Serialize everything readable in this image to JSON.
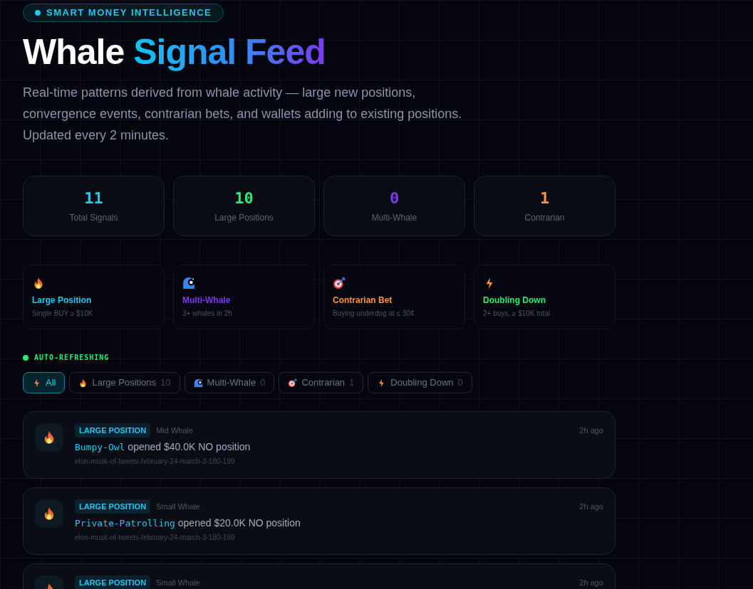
{
  "badge": "SMART MONEY INTELLIGENCE",
  "title": {
    "plain": "Whale",
    "accent": "Signal Feed"
  },
  "description": "Real-time patterns derived from whale activity — large new positions, convergence events, contrarian bets, and wallets adding to existing positions. Updated every 2 minutes.",
  "stats": [
    {
      "value": "11",
      "label": "Total Signals",
      "color": "#22c8ee"
    },
    {
      "value": "10",
      "label": "Large Positions",
      "color": "#22ee77"
    },
    {
      "value": "0",
      "label": "Multi-Whale",
      "color": "#7c3aed"
    },
    {
      "value": "1",
      "label": "Contrarian",
      "color": "#fb923c"
    }
  ],
  "signal_types": [
    {
      "kind": "flame",
      "name": "Large Position",
      "rule": "Single BUY ≥ $10K",
      "color": "#22c8ee"
    },
    {
      "kind": "wave",
      "name": "Multi-Whale",
      "rule": "3+ whales in 2h",
      "color": "#7c3aed"
    },
    {
      "kind": "target",
      "name": "Contrarian Bet",
      "rule": "Buying underdog at ≤ 30¢",
      "color": "#fb923c"
    },
    {
      "kind": "bolt",
      "name": "Doubling Down",
      "rule": "2+ buys, ≥ $10K total",
      "color": "#22ee77"
    }
  ],
  "status": "AUTO-REFRESHING",
  "filters": [
    {
      "kind": "bolt",
      "label": "All",
      "selected": true
    },
    {
      "kind": "flame",
      "label": "Large Positions",
      "count": "10",
      "selected": false
    },
    {
      "kind": "wave",
      "label": "Multi-Whale",
      "count": "0",
      "selected": false
    },
    {
      "kind": "target",
      "label": "Contrarian",
      "count": "1",
      "selected": false
    },
    {
      "kind": "bolt",
      "label": "Doubling Down",
      "count": "0",
      "selected": false
    }
  ],
  "feed": [
    {
      "kind": "flame",
      "tag": "LARGE POSITION",
      "tier": "Mid Whale",
      "time": "2h ago",
      "wallet": "Bumpy-Owl",
      "action": "opened $40.0K NO position",
      "market": "elon-musk-of-tweets-february-24-march-3-180-199"
    },
    {
      "kind": "flame",
      "tag": "LARGE POSITION",
      "tier": "Small Whale",
      "time": "2h ago",
      "wallet": "Private-Patrolling",
      "action": "opened $20.0K NO position",
      "market": "elon-musk-of-tweets-february-24-march-3-180-199"
    },
    {
      "kind": "flame",
      "tag": "LARGE POSITION",
      "tier": "Small Whale",
      "time": "2h ago"
    }
  ]
}
